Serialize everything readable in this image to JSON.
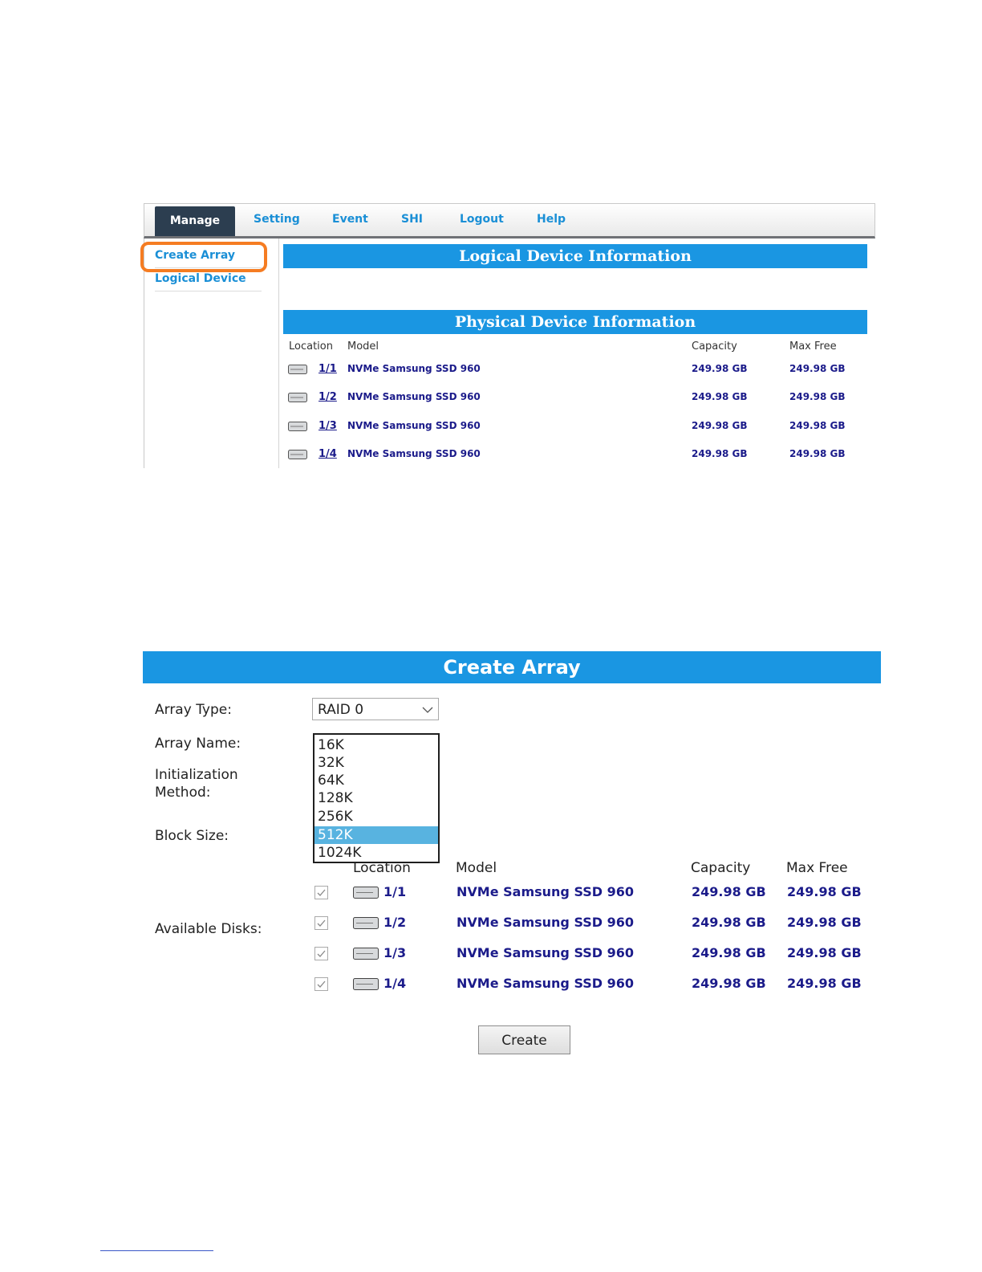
{
  "nav": {
    "tabs": [
      {
        "label": "Manage"
      },
      {
        "label": "Setting"
      },
      {
        "label": "Event"
      },
      {
        "label": "SHI"
      },
      {
        "label": "Logout"
      },
      {
        "label": "Help"
      }
    ]
  },
  "sidebar": {
    "create_array": "Create Array",
    "logical_device": "Logical Device",
    "highlight_color": "#f57c22"
  },
  "logical_section": {
    "title": "Logical Device Information"
  },
  "physical_section": {
    "title": "Physical Device Information",
    "columns": {
      "location": "Location",
      "model": "Model",
      "capacity": "Capacity",
      "max_free": "Max Free"
    },
    "rows": [
      {
        "location": "1/1",
        "model": "NVMe Samsung SSD 960",
        "capacity": "249.98 GB",
        "max_free": "249.98 GB"
      },
      {
        "location": "1/2",
        "model": "NVMe Samsung SSD 960",
        "capacity": "249.98 GB",
        "max_free": "249.98 GB"
      },
      {
        "location": "1/3",
        "model": "NVMe Samsung SSD 960",
        "capacity": "249.98 GB",
        "max_free": "249.98 GB"
      },
      {
        "location": "1/4",
        "model": "NVMe Samsung SSD 960",
        "capacity": "249.98 GB",
        "max_free": "249.98 GB"
      }
    ]
  },
  "create_array": {
    "title": "Create Array",
    "labels": {
      "array_type": "Array Type:",
      "array_name": "Array Name:",
      "init_method_line1": "Initialization",
      "init_method_line2": "Method:",
      "block_size": "Block Size:",
      "available_disks": "Available Disks:"
    },
    "array_type_value": "RAID 0",
    "block_size_options": [
      "16K",
      "32K",
      "64K",
      "128K",
      "256K",
      "512K",
      "1024K"
    ],
    "block_size_selected": "512K",
    "columns": {
      "location": "Location",
      "model": "Model",
      "capacity": "Capacity",
      "max_free": "Max Free"
    },
    "disks": [
      {
        "location": "1/1",
        "model": "NVMe Samsung SSD 960",
        "capacity": "249.98 GB",
        "max_free": "249.98 GB",
        "checked": true
      },
      {
        "location": "1/2",
        "model": "NVMe Samsung SSD 960",
        "capacity": "249.98 GB",
        "max_free": "249.98 GB",
        "checked": true
      },
      {
        "location": "1/3",
        "model": "NVMe Samsung SSD 960",
        "capacity": "249.98 GB",
        "max_free": "249.98 GB",
        "checked": true
      },
      {
        "location": "1/4",
        "model": "NVMe Samsung SSD 960",
        "capacity": "249.98 GB",
        "max_free": "249.98 GB",
        "checked": true
      }
    ],
    "create_button": "Create"
  },
  "colors": {
    "accent_blue": "#1a96e2",
    "nav_active": "#2c3e50",
    "data_text": "#1b1b8a",
    "selected_option": "#58b3e0"
  }
}
